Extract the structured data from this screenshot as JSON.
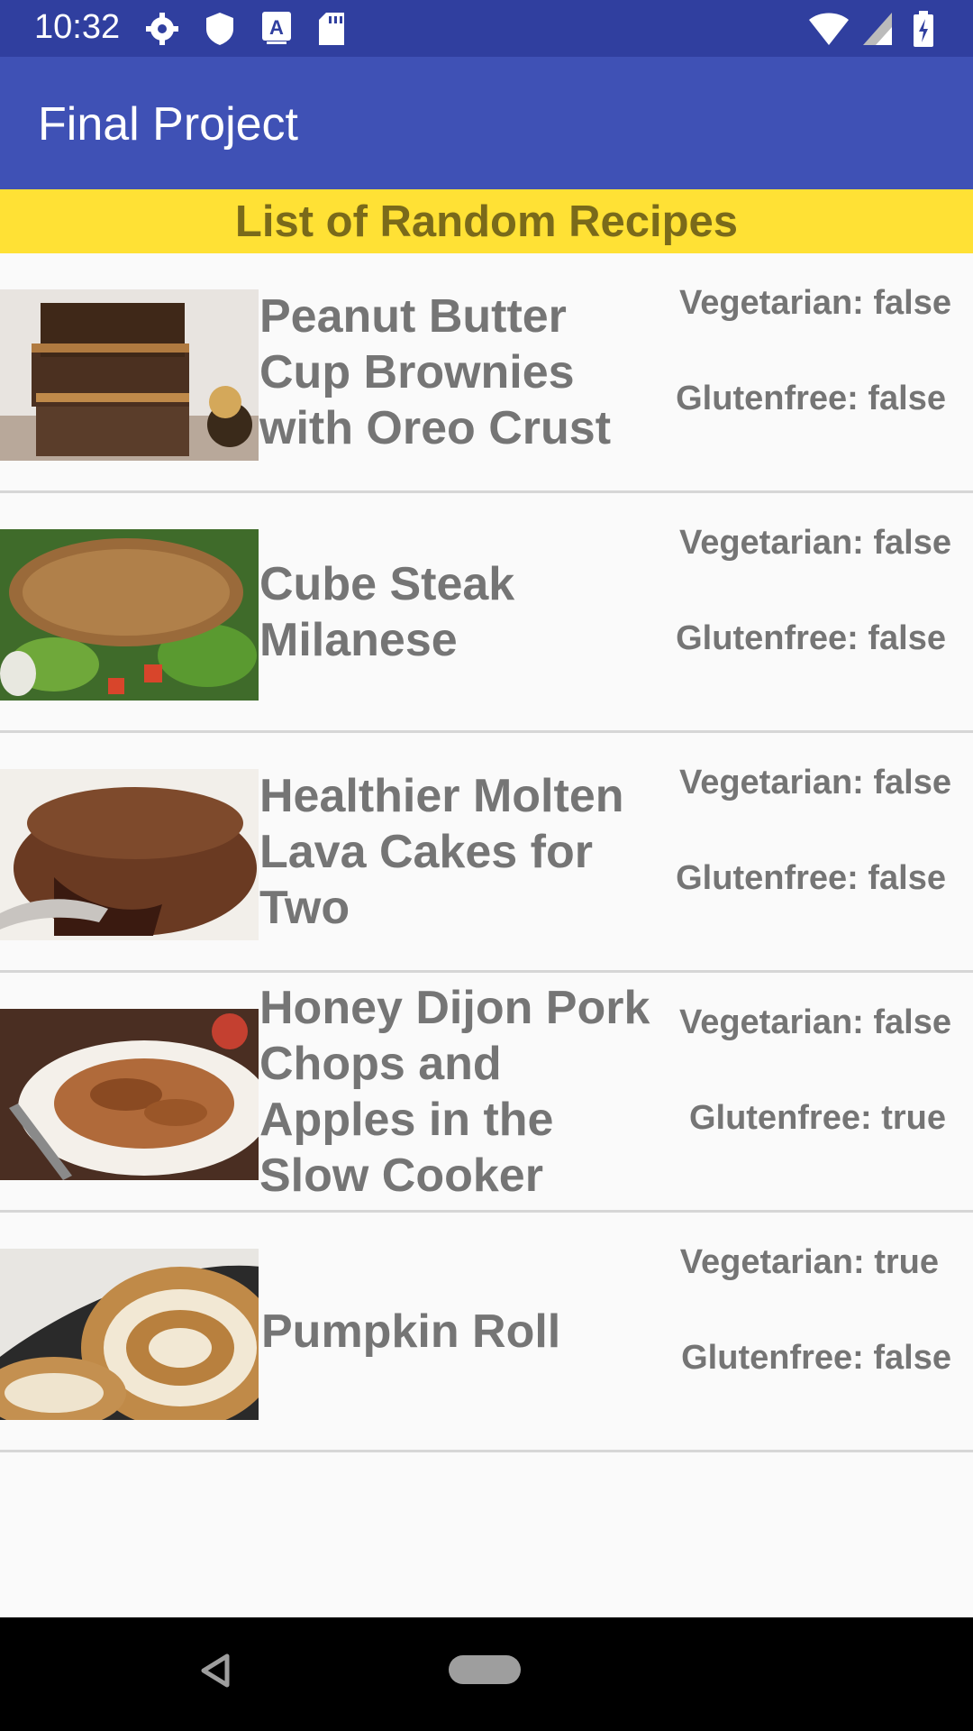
{
  "status_bar": {
    "time": "10:32",
    "icons_left": [
      "gear-icon",
      "shield-icon",
      "font-a-icon",
      "sd-card-icon"
    ],
    "icons_right": [
      "wifi-icon",
      "signal-icon",
      "battery-charging-icon"
    ]
  },
  "app_bar": {
    "title": "Final Project"
  },
  "banner": {
    "text": "List of Random Recipes",
    "color": "#ffe135"
  },
  "recipes": [
    {
      "name": "Peanut Butter Cup Brownies with Oreo Crust",
      "vegetarian": "Vegetarian: false",
      "glutenfree": "Glutenfree: false",
      "image": "brownies-photo"
    },
    {
      "name": "Cube Steak Milanese",
      "vegetarian": "Vegetarian: false",
      "glutenfree": "Glutenfree: false",
      "image": "cube-steak-photo"
    },
    {
      "name": "Healthier Molten Lava Cakes for Two",
      "vegetarian": "Vegetarian: false",
      "glutenfree": "Glutenfree: false",
      "image": "lava-cake-photo"
    },
    {
      "name": "Honey Dijon Pork Chops and Apples in the Slow Cooker",
      "vegetarian": "Vegetarian: false",
      "glutenfree": "Glutenfree: true",
      "image": "pork-chops-photo"
    },
    {
      "name": "Pumpkin Roll",
      "vegetarian": "Vegetarian: true",
      "glutenfree": "Glutenfree: false",
      "image": "pumpkin-roll-photo"
    }
  ],
  "colors": {
    "status_bar": "#303f9f",
    "app_bar": "#3f51b5",
    "text_gray": "#757575"
  }
}
